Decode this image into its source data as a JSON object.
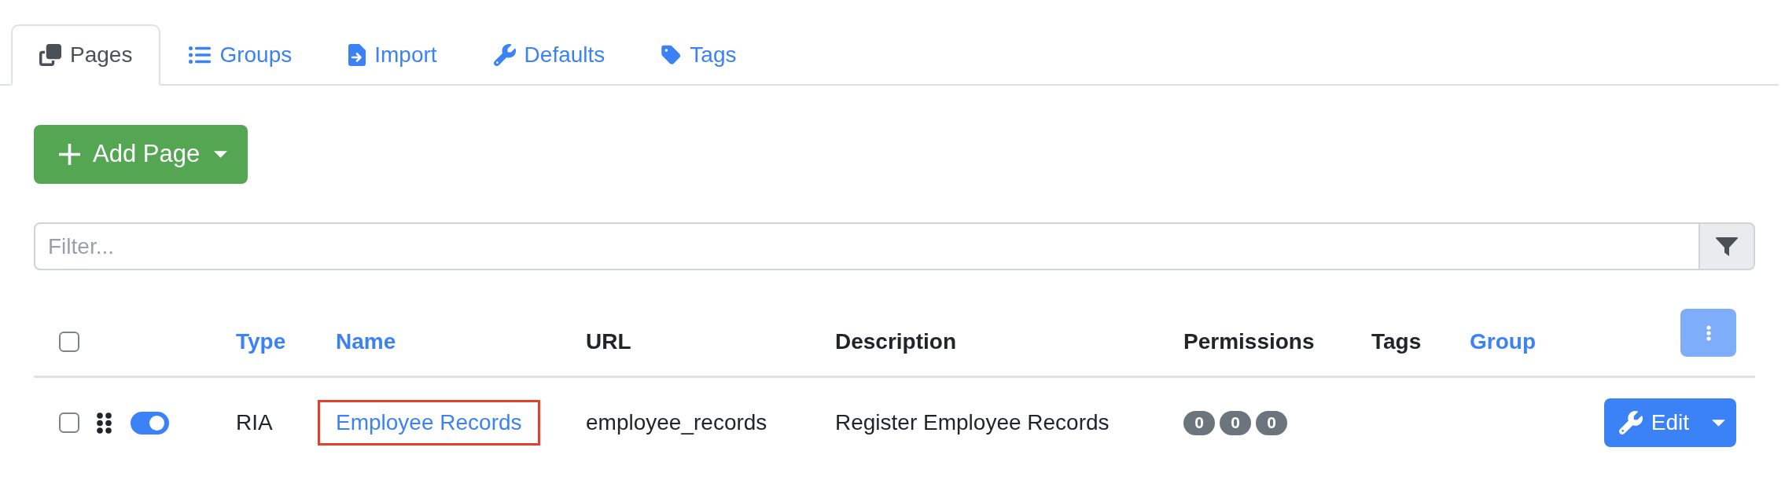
{
  "tabs": [
    {
      "label": "Pages",
      "selected": true
    },
    {
      "label": "Groups",
      "selected": false
    },
    {
      "label": "Import",
      "selected": false
    },
    {
      "label": "Defaults",
      "selected": false
    },
    {
      "label": "Tags",
      "selected": false
    }
  ],
  "add_button": {
    "label": "Add Page"
  },
  "filter": {
    "placeholder": "Filter..."
  },
  "table": {
    "select_all": {
      "checked": false
    },
    "columns": [
      {
        "label": "Type",
        "sortable": true
      },
      {
        "label": "Name",
        "sortable": true
      },
      {
        "label": "URL",
        "sortable": false
      },
      {
        "label": "Description",
        "sortable": false
      },
      {
        "label": "Permissions",
        "sortable": false
      },
      {
        "label": "Tags",
        "sortable": false
      },
      {
        "label": "Group",
        "sortable": true
      }
    ],
    "options_button": {
      "disabled": true
    },
    "rows": [
      {
        "checked": false,
        "enabled": true,
        "type": "RIA",
        "name": "Employee Records",
        "highlighted": true,
        "url": "employee_records",
        "description": "Register Employee Records",
        "permissions": [
          "0",
          "0",
          "0"
        ],
        "action": "Edit"
      }
    ]
  }
}
